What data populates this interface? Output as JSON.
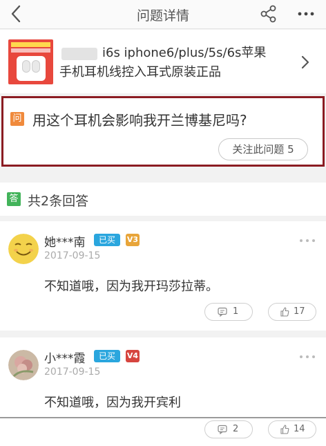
{
  "header": {
    "title": "问题详情"
  },
  "product": {
    "title_line1": "i6s iphone6/plus/5s/6s苹果",
    "title_line2": "手机耳机线控入耳式原装正品"
  },
  "question": {
    "badge": "问",
    "text": "用这个耳机会影响我开兰博基尼吗?",
    "follow_label": "关注此问题 5"
  },
  "answers_header": {
    "badge": "答",
    "count_text": "共2条回答"
  },
  "answers": [
    {
      "user": "她***南",
      "bought_label": "已买",
      "level": "V3",
      "date": "2017-09-15",
      "text": "不知道哦，因为我开玛莎拉蒂。",
      "comments": "1",
      "likes": "17"
    },
    {
      "user": "小***霞",
      "bought_label": "已买",
      "level": "V4",
      "date": "2017-09-15",
      "text": "不知道哦，因为我开宾利",
      "comments": "2",
      "likes": "14"
    }
  ],
  "colors": {
    "question_border": "#8b1c22",
    "question_badge": "#f08a3c",
    "answer_badge": "#42b35a",
    "bought_badge": "#2aa6de",
    "v3_badge": "#e8a53a",
    "v4_badge": "#d6453f"
  }
}
